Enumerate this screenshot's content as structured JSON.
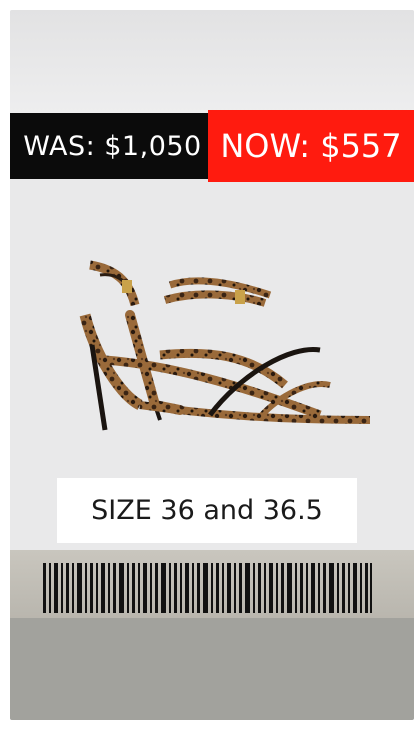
{
  "price": {
    "was_label": "WAS: $1,050",
    "now_label": "NOW: $557"
  },
  "product": {
    "image_icon": "leopard-print-strappy-heel-sandal"
  },
  "size": {
    "label": "SIZE 36 and 36.5"
  },
  "colors": {
    "was_bg": "#0b0b0b",
    "now_bg": "#ff1b0f",
    "card_bg": "#e9e9ea"
  }
}
